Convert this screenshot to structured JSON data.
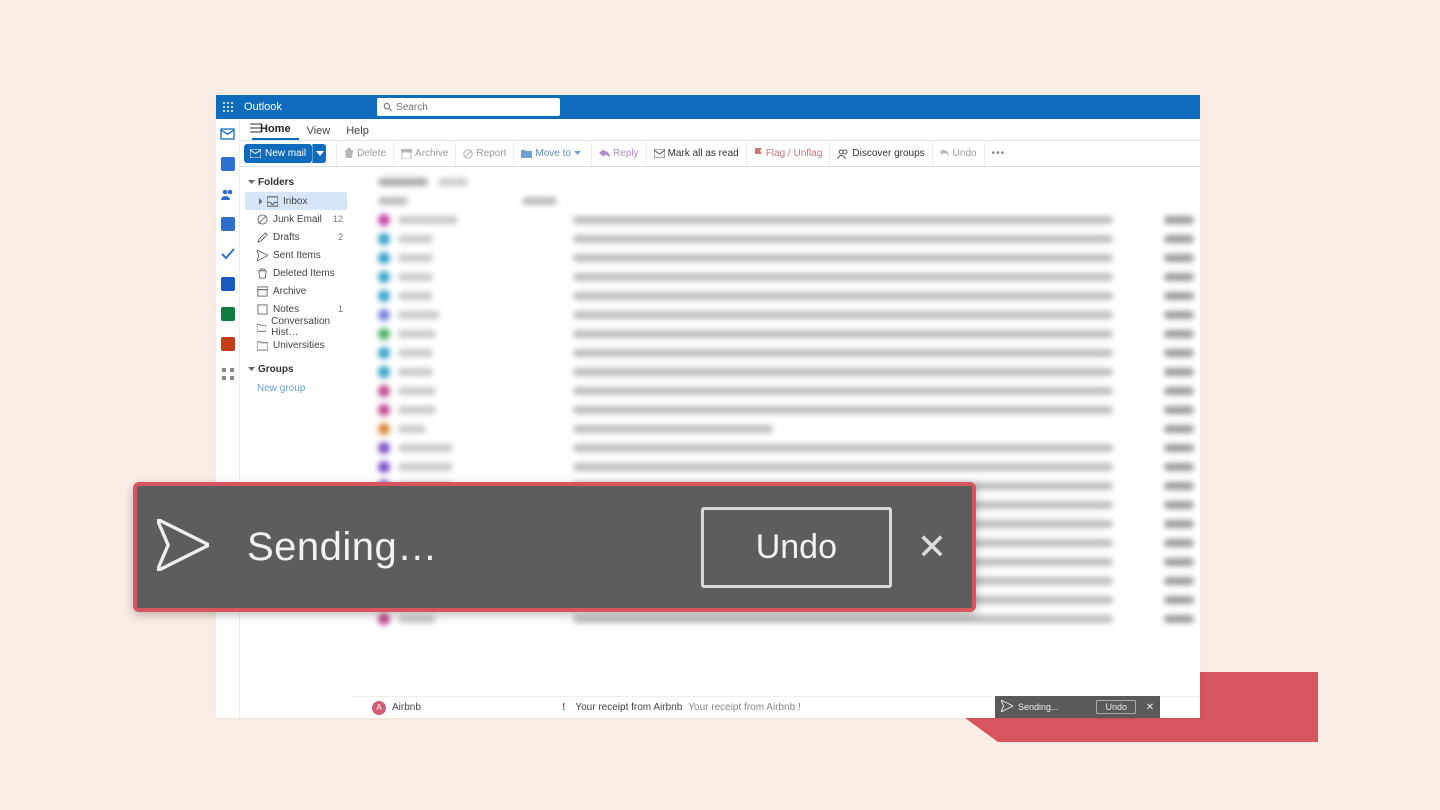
{
  "titlebar": {
    "product": "Outlook"
  },
  "search": {
    "placeholder": "Search"
  },
  "tabs": {
    "home": "Home",
    "view": "View",
    "help": "Help"
  },
  "toolbar": {
    "new_mail": "New mail",
    "delete": "Delete",
    "archive": "Archive",
    "report": "Report",
    "move_to": "Move to",
    "reply": "Reply",
    "mark_all_read": "Mark all as read",
    "flag": "Flag / Unflag",
    "discover": "Discover groups",
    "undo": "Undo"
  },
  "sidebar": {
    "folders_header": "Folders",
    "groups_header": "Groups",
    "new_group": "New group",
    "items": [
      {
        "label": "Inbox",
        "count": ""
      },
      {
        "label": "Junk Email",
        "count": "12"
      },
      {
        "label": "Drafts",
        "count": "2"
      },
      {
        "label": "Sent Items",
        "count": ""
      },
      {
        "label": "Deleted Items",
        "count": ""
      },
      {
        "label": "Archive",
        "count": ""
      },
      {
        "label": "Notes",
        "count": "1"
      },
      {
        "label": "Conversation Hist…",
        "count": ""
      },
      {
        "label": "Universities",
        "count": ""
      }
    ]
  },
  "message_row": {
    "avatar_letter": "A",
    "sender": "Airbnb",
    "priority": "!",
    "subject": "Your receipt from Airbnb",
    "preview": "Your receipt from Airbnb !"
  },
  "toast": {
    "status": "Sending…",
    "undo": "Undo",
    "status_small": "Sending..."
  },
  "rail_apps": {
    "mail_color": "#0f6cbd",
    "calendar_color": "#106ebe",
    "people_color": "#0f6cbd",
    "todo_color": "#2564cf",
    "word_color": "#185abd",
    "excel_color": "#107c41",
    "powerpoint_color": "#c43e1c",
    "more_color": "#777777"
  },
  "blur_rows": [
    {
      "c": "#c243a3",
      "n": 60,
      "s": 540
    },
    {
      "c": "#36a3c9",
      "n": 35,
      "s": 540
    },
    {
      "c": "#36a3c9",
      "n": 35,
      "s": 540
    },
    {
      "c": "#36a3c9",
      "n": 35,
      "s": 540
    },
    {
      "c": "#36a3c9",
      "n": 35,
      "s": 540
    },
    {
      "c": "#7382d9",
      "n": 42,
      "s": 540
    },
    {
      "c": "#4cb368",
      "n": 38,
      "s": 540
    },
    {
      "c": "#36a3c9",
      "n": 35,
      "s": 540
    },
    {
      "c": "#36a3c9",
      "n": 35,
      "s": 540
    },
    {
      "c": "#c14891",
      "n": 38,
      "s": 540
    },
    {
      "c": "#c14891",
      "n": 38,
      "s": 540
    },
    {
      "c": "#d98a3c",
      "n": 28,
      "s": 200
    },
    {
      "c": "#7a52c9",
      "n": 55,
      "s": 540
    },
    {
      "c": "#7a52c9",
      "n": 55,
      "s": 540
    },
    {
      "c": "#7a52c9",
      "n": 55,
      "s": 540
    },
    {
      "c": "#7a52c9",
      "n": 55,
      "s": 540
    },
    {
      "c": "#7a52c9",
      "n": 55,
      "s": 540
    },
    {
      "c": "#36a3c9",
      "n": 38,
      "s": 540
    },
    {
      "c": "#c14891",
      "n": 38,
      "s": 540
    },
    {
      "c": "#7a52c9",
      "n": 90,
      "s": 540
    },
    {
      "c": "#c14891",
      "n": 38,
      "s": 540
    },
    {
      "c": "#c14891",
      "n": 38,
      "s": 540
    }
  ]
}
